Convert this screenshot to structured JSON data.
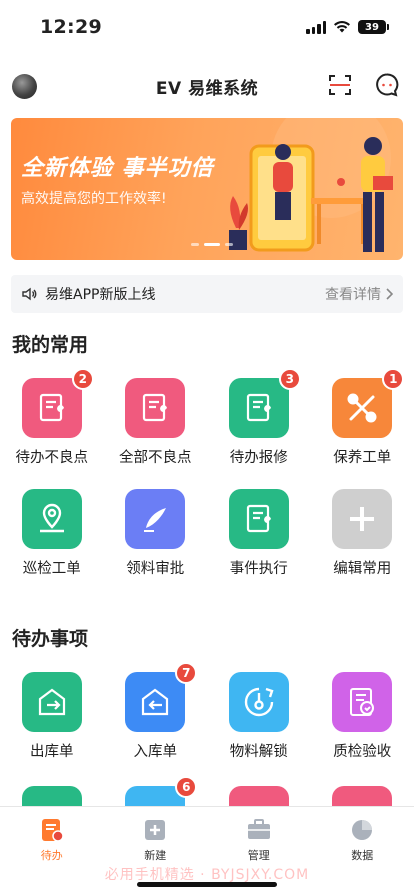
{
  "status": {
    "time": "12:29",
    "battery": "39"
  },
  "header": {
    "title": "EV 易维系统",
    "avatar_icon": "avatar",
    "scan_icon": "scan-icon",
    "chat_icon": "chat-icon"
  },
  "banner": {
    "headline": "全新体验  事半功倍",
    "subtitle": "高效提高您的工作效率!",
    "active_dot": 1,
    "dot_count": 3
  },
  "notice": {
    "text": "易维APP新版上线",
    "more": "查看详情"
  },
  "common": {
    "title": "我的常用",
    "items": [
      {
        "label": "待办不良点",
        "badge": "2",
        "color": "#f05a7e",
        "icon": "document-wrench-icon"
      },
      {
        "label": "全部不良点",
        "badge": "",
        "color": "#f05a7e",
        "icon": "document-wrench-icon"
      },
      {
        "label": "待办报修",
        "badge": "3",
        "color": "#27b985",
        "icon": "document-wrench-icon"
      },
      {
        "label": "保养工单",
        "badge": "1",
        "color": "#f7873a",
        "icon": "tools-icon"
      },
      {
        "label": "巡检工单",
        "badge": "",
        "color": "#27b985",
        "icon": "location-pin-icon"
      },
      {
        "label": "领料审批",
        "badge": "",
        "color": "#6b7ef5",
        "icon": "pen-icon"
      },
      {
        "label": "事件执行",
        "badge": "",
        "color": "#27b985",
        "icon": "document-wrench-icon"
      },
      {
        "label": "编辑常用",
        "badge": "",
        "color": "#cfcfcf",
        "icon": "plus-icon"
      }
    ]
  },
  "todo": {
    "title": "待办事项",
    "items": [
      {
        "label": "出库单",
        "badge": "",
        "color": "#27b985",
        "icon": "warehouse-out-icon"
      },
      {
        "label": "入库单",
        "badge": "7",
        "color": "#3d8bf5",
        "icon": "warehouse-in-icon"
      },
      {
        "label": "物料解锁",
        "badge": "",
        "color": "#3fb6f2",
        "icon": "unlock-icon"
      },
      {
        "label": "质检验收",
        "badge": "",
        "color": "#d063e8",
        "icon": "inspection-doc-icon"
      }
    ],
    "partial_row": [
      {
        "badge": "",
        "color": "#27b985"
      },
      {
        "badge": "6",
        "color": "#3fb6f2"
      },
      {
        "badge": "",
        "color": "#f05a7e"
      },
      {
        "badge": "",
        "color": "#f05a7e"
      }
    ]
  },
  "tabs": [
    {
      "label": "待办",
      "icon": "todo-tab-icon",
      "active": true
    },
    {
      "label": "新建",
      "icon": "new-tab-icon",
      "active": false
    },
    {
      "label": "管理",
      "icon": "briefcase-tab-icon",
      "active": false
    },
    {
      "label": "数据",
      "icon": "pie-chart-tab-icon",
      "active": false
    }
  ],
  "watermark": "必用手机精选 · BYJSJXY.COM",
  "accent": "#ff7a2f"
}
